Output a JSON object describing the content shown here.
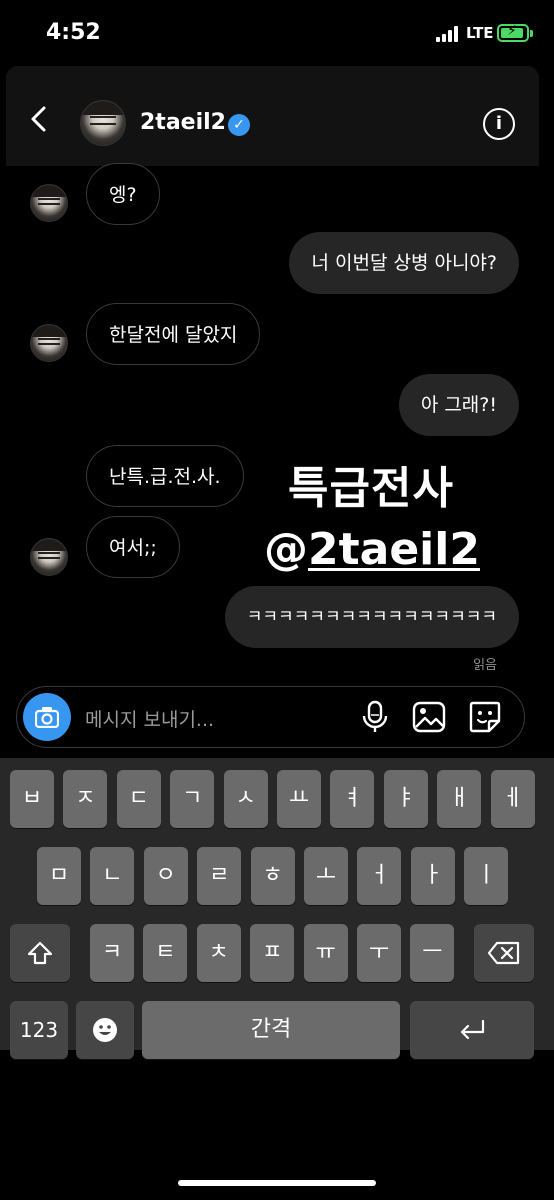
{
  "status_bar": {
    "time": "4:52",
    "network": "LTE",
    "battery_level": 0.8
  },
  "header": {
    "username": "2taeil2",
    "verified": true
  },
  "messages": [
    {
      "side": "in",
      "text": "엥?"
    },
    {
      "side": "out",
      "text": "너 이번달 상병 아니야?"
    },
    {
      "side": "in",
      "text": "한달전에 달았지"
    },
    {
      "side": "out",
      "text": "아 그래?!"
    },
    {
      "side": "in",
      "text": "난특.급.전.사."
    },
    {
      "side": "in",
      "text": "여서;;"
    },
    {
      "side": "out",
      "text": "ㅋㅋㅋㅋㅋㅋㅋㅋㅋㅋㅋㅋㅋㅋㅋㅋ"
    }
  ],
  "seen_label": "읽음",
  "overlay": {
    "line1": "특급전사",
    "line2_prefix": "@",
    "line2_handle": "2taeil2"
  },
  "composer": {
    "placeholder": "메시지 보내기..."
  },
  "keyboard": {
    "row1": [
      "ㅂ",
      "ㅈ",
      "ㄷ",
      "ㄱ",
      "ㅅ",
      "ㅛ",
      "ㅕ",
      "ㅑ",
      "ㅐ",
      "ㅔ"
    ],
    "row2": [
      "ㅁ",
      "ㄴ",
      "ㅇ",
      "ㄹ",
      "ㅎ",
      "ㅗ",
      "ㅓ",
      "ㅏ",
      "ㅣ"
    ],
    "row3": [
      "ㅋ",
      "ㅌ",
      "ㅊ",
      "ㅍ",
      "ㅠ",
      "ㅜ",
      "ㅡ"
    ],
    "numbers_label": "123",
    "space_label": "간격"
  }
}
